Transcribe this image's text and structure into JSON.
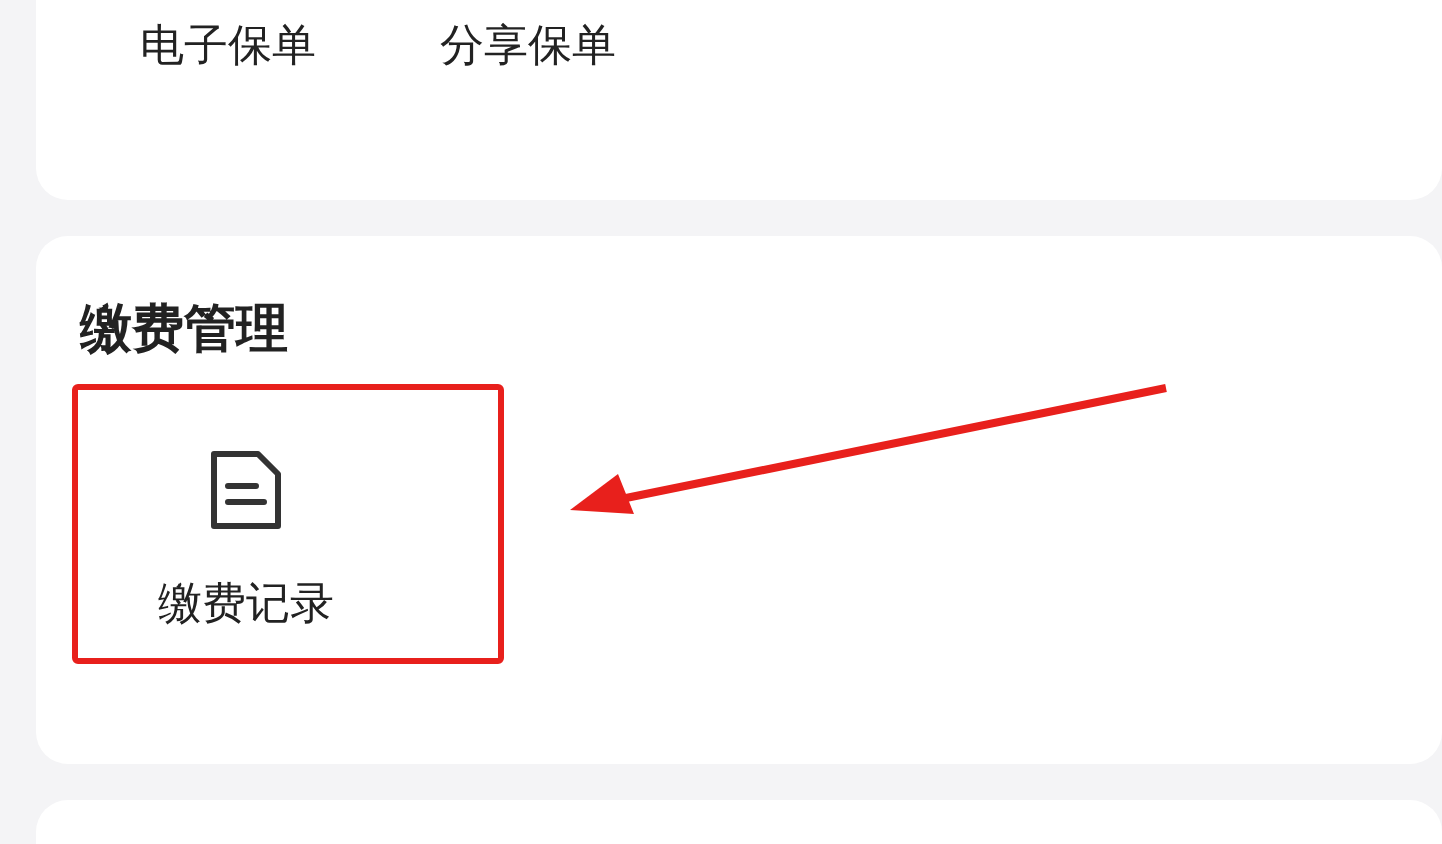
{
  "policy_card": {
    "items": [
      {
        "label": "电子保单"
      },
      {
        "label": "分享保单"
      }
    ]
  },
  "payment_section": {
    "title": "缴费管理",
    "items": [
      {
        "label": "缴费记录",
        "highlighted": true
      }
    ]
  }
}
